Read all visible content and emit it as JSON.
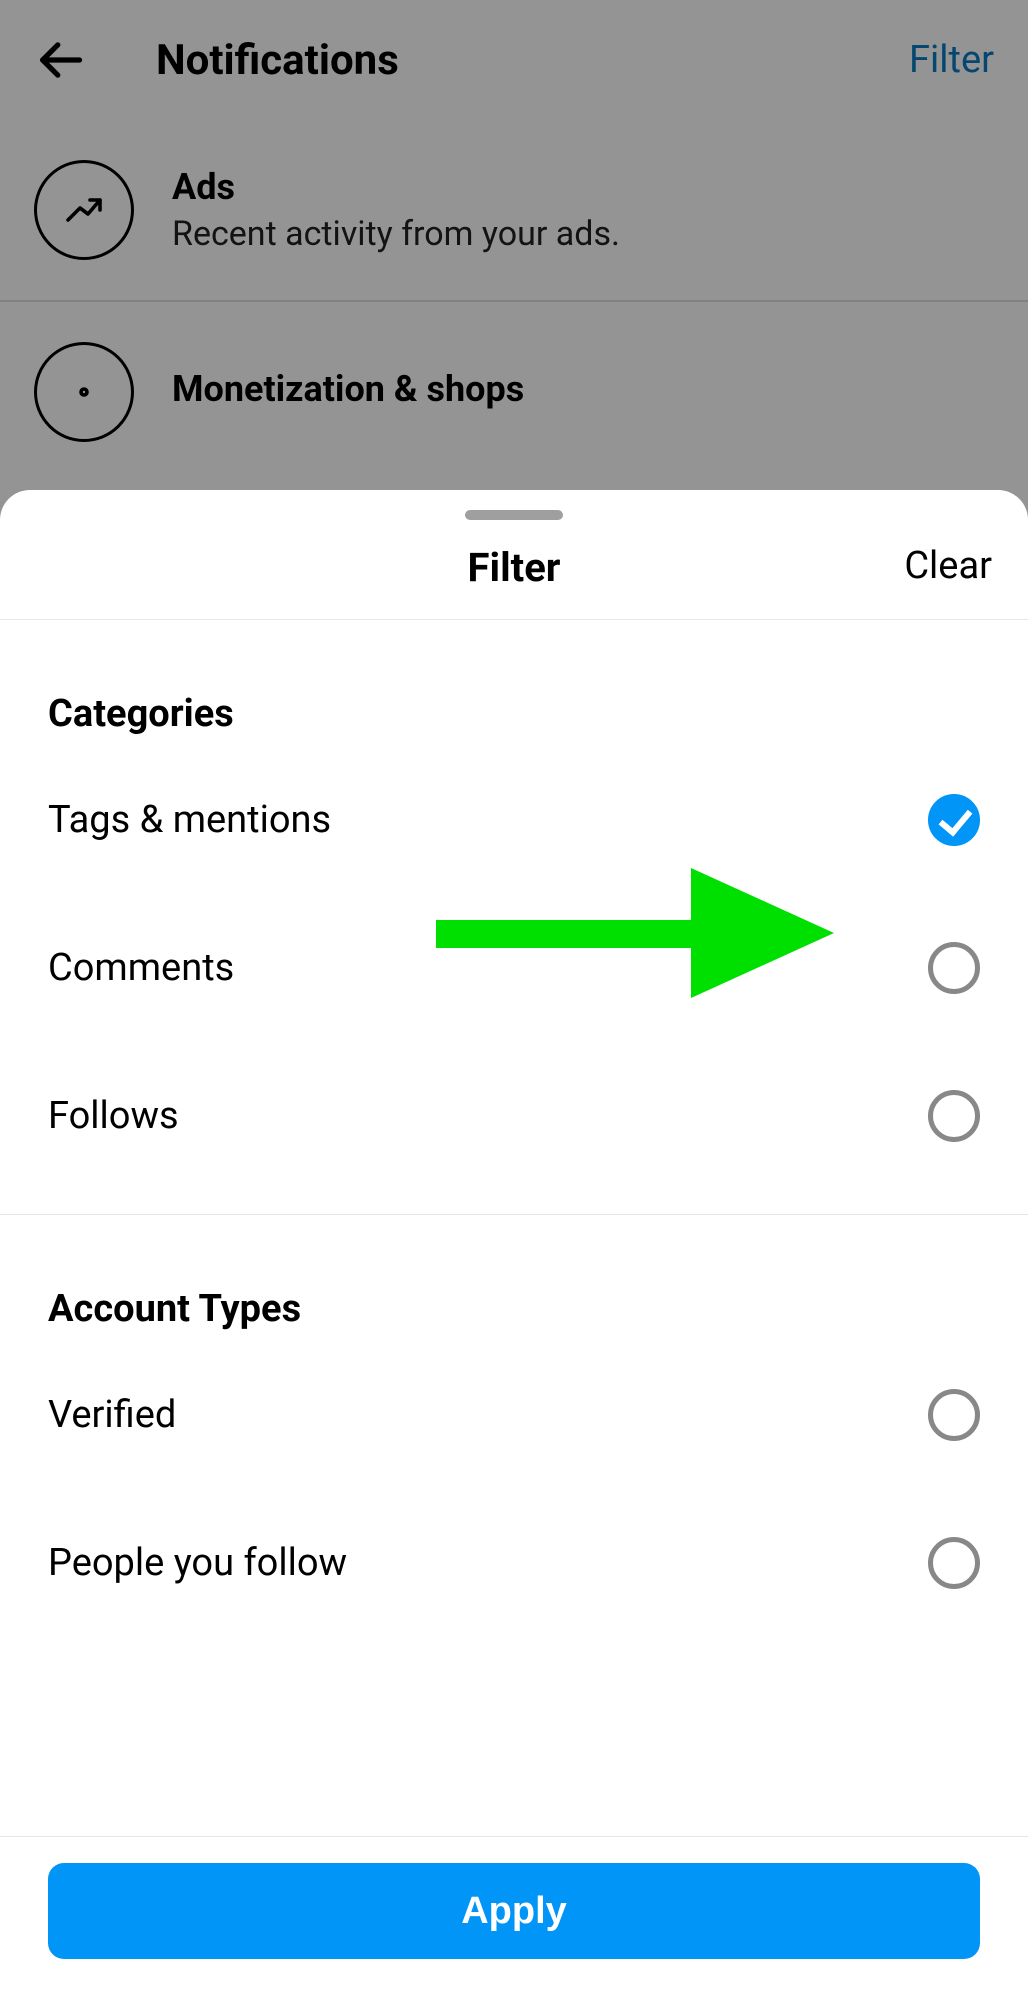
{
  "header": {
    "title": "Notifications",
    "filter_link": "Filter"
  },
  "bg_items": [
    {
      "title": "Ads",
      "subtitle": "Recent activity from your ads."
    },
    {
      "title": "Monetization & shops",
      "subtitle": ""
    }
  ],
  "sheet": {
    "title": "Filter",
    "clear_label": "Clear",
    "sections": [
      {
        "header": "Categories",
        "options": [
          {
            "label": "Tags & mentions",
            "checked": true
          },
          {
            "label": "Comments",
            "checked": false
          },
          {
            "label": "Follows",
            "checked": false
          }
        ]
      },
      {
        "header": "Account Types",
        "options": [
          {
            "label": "Verified",
            "checked": false
          },
          {
            "label": "People you follow",
            "checked": false
          }
        ]
      }
    ],
    "apply_label": "Apply"
  },
  "annotation": {
    "arrow_color": "#00e000"
  }
}
